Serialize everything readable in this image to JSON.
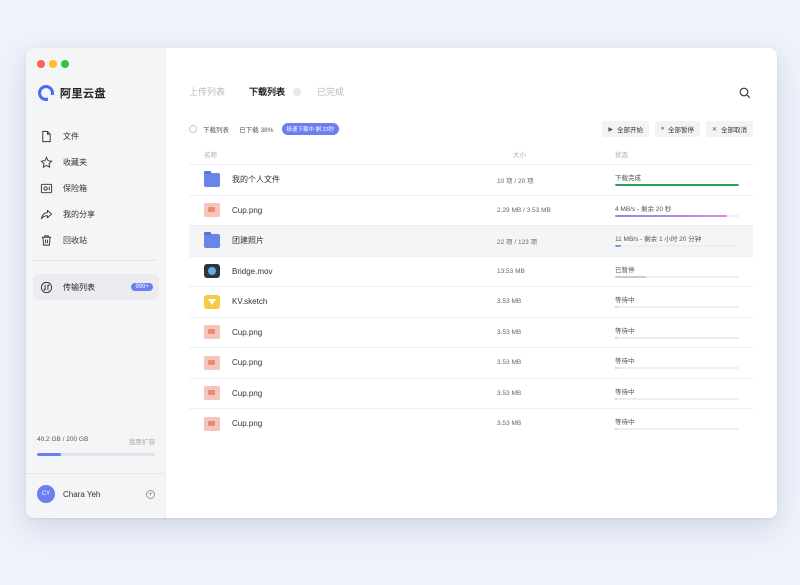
{
  "app": {
    "name": "阿里云盘"
  },
  "sidebar": {
    "items": [
      {
        "label": "文件",
        "icon": "file-icon"
      },
      {
        "label": "收藏夹",
        "icon": "star-icon"
      },
      {
        "label": "保险箱",
        "icon": "safe-icon"
      },
      {
        "label": "我的分享",
        "icon": "share-icon"
      },
      {
        "label": "回收站",
        "icon": "trash-icon"
      }
    ],
    "active_item": {
      "label": "传输列表",
      "icon": "transfer-icon",
      "badge": "999+"
    },
    "storage": {
      "used": "40.2 GB / 200 GB",
      "plan": "我要扩容",
      "fraction": 0.2
    },
    "user": {
      "name": "Chara Yeh",
      "initials": "CY"
    }
  },
  "tabs": [
    {
      "label": "上传列表",
      "active": false
    },
    {
      "label": "下载列表",
      "active": true
    },
    {
      "label": "已完成",
      "active": false
    }
  ],
  "toolbar": {
    "list_label": "下载列表",
    "progress": "已下载 38%",
    "speed_tag": "极速下载中 剩 23秒",
    "start_all": "全部开始",
    "pause_all": "全部暂停",
    "cancel_all": "全部取消"
  },
  "table": {
    "headers": {
      "name": "名称",
      "size": "大小",
      "status": "状态"
    },
    "rows": [
      {
        "name": "我的个人文件",
        "type": "folder",
        "size": "10 项 / 20 项",
        "status": "下载完成",
        "progress": 1.0,
        "color": "#2aa45a",
        "highlight": false
      },
      {
        "name": "Cup.png",
        "type": "png",
        "size": "2.29 MB / 3.53 MB",
        "status": "4 MB/s - 剩余 20 秒",
        "progress": 0.9,
        "color": "#7f8ef2",
        "highlight": false
      },
      {
        "name": "团建照片",
        "type": "folder",
        "size": "22 项 / 123 项",
        "status": "11 MB/s - 剩余 1 小时 20 分钟",
        "progress": 0.05,
        "color": "#7f8ef2",
        "highlight": true
      },
      {
        "name": "Bridge.mov",
        "type": "mov",
        "size": "13.53 MB",
        "status": "已暂停",
        "progress": 0.25,
        "color": "#c8cbd2",
        "highlight": false
      },
      {
        "name": "KV.sketch",
        "type": "sketch",
        "size": "3.53 MB",
        "status": "等待中",
        "progress": 0.02,
        "color": "#c8cbd2",
        "highlight": false
      },
      {
        "name": "Cup.png",
        "type": "png",
        "size": "3.53 MB",
        "status": "等待中",
        "progress": 0.02,
        "color": "#c8cbd2",
        "highlight": false
      },
      {
        "name": "Cup.png",
        "type": "png",
        "size": "3.53 MB",
        "status": "等待中",
        "progress": 0.02,
        "color": "#c8cbd2",
        "highlight": false
      },
      {
        "name": "Cup.png",
        "type": "png",
        "size": "3.53 MB",
        "status": "等待中",
        "progress": 0.02,
        "color": "#c8cbd2",
        "highlight": false
      },
      {
        "name": "Cup.png",
        "type": "png",
        "size": "3.53 MB",
        "status": "等待中",
        "progress": 0.02,
        "color": "#c8cbd2",
        "highlight": false
      }
    ]
  },
  "colors": {
    "accent": "#6b7ef2",
    "success": "#2aa45a"
  }
}
